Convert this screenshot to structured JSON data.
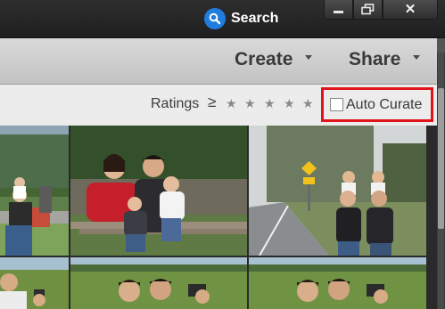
{
  "titlebar": {
    "search_label": "Search",
    "icons": {
      "search": "search-icon",
      "minimize": "minimize-icon",
      "restore": "restore-icon",
      "close": "close-icon"
    }
  },
  "toolbar": {
    "create_label": "Create",
    "share_label": "Share"
  },
  "filterbar": {
    "ratings_label": "Ratings",
    "ratings_operator": "≥",
    "ratings_stars": 5,
    "auto_curate_label": "Auto Curate",
    "auto_curate_checked": false,
    "highlight_color": "#e0151c"
  },
  "colors": {
    "search_blue": "#1f7de0"
  }
}
